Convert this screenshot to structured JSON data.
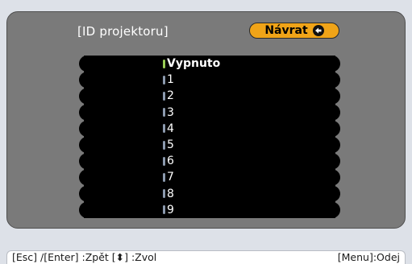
{
  "dialog": {
    "title": "[ID projektoru]",
    "return_label": "Návrat"
  },
  "options": [
    "Vypnuto",
    "1",
    "2",
    "3",
    "4",
    "5",
    "6",
    "7",
    "8",
    "9"
  ],
  "selected_index": 0,
  "help": {
    "left": "[Esc] /[Enter] :Zpět  [⬍] :Zvol",
    "right": "[Menu]:Odej"
  },
  "colors": {
    "panel": "#7a7a7a",
    "list": "#000000",
    "button": "#f0a418",
    "selected_marker": "#99cc55",
    "marker": "#8c9aae"
  },
  "icons": {
    "return": "enter-arrow-icon"
  }
}
